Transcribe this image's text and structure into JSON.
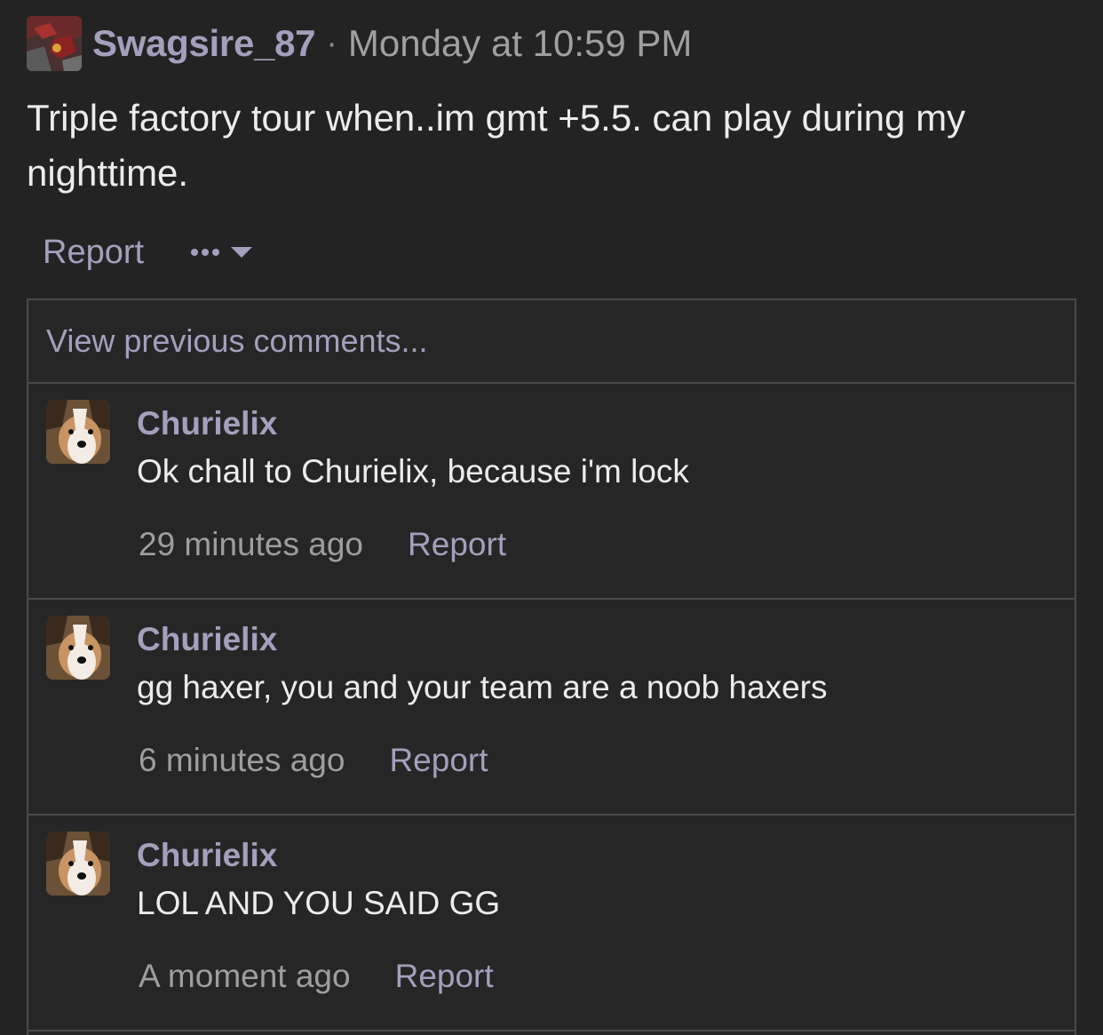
{
  "post": {
    "author": "Swagsire_87",
    "separator": "·",
    "timestamp": "Monday at 10:59 PM",
    "body": "Triple factory tour when..im gmt +5.5. can play during my nighttime.",
    "report_label": "Report",
    "more_icon": "ellipsis-dropdown-icon"
  },
  "comments": {
    "view_previous_label": "View previous comments...",
    "items": [
      {
        "author": "Churielix",
        "text": "Ok chall to Churielix, because i'm lock",
        "time": "29 minutes ago",
        "report_label": "Report"
      },
      {
        "author": "Churielix",
        "text": "gg haxer, you and your team are a noob haxers",
        "time": "6 minutes ago",
        "report_label": "Report"
      },
      {
        "author": "Churielix",
        "text": "LOL AND YOU SAID GG",
        "time": "A moment ago",
        "report_label": "Report"
      }
    ]
  },
  "colors": {
    "background": "#232323",
    "accent": "#a59fbd",
    "text": "#ececec",
    "muted": "#9e9e9e",
    "border": "#4a4a4a"
  }
}
